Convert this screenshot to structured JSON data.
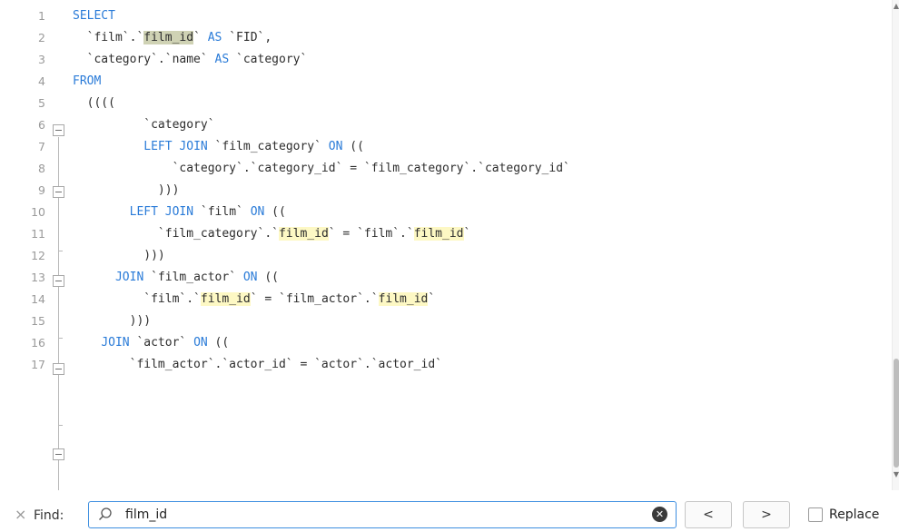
{
  "editor": {
    "lines": [
      {
        "num": "1",
        "segments": [
          {
            "t": "SELECT",
            "c": "kw"
          }
        ]
      },
      {
        "num": "2",
        "segments": [
          {
            "t": "  `film`.`"
          },
          {
            "t": "film_id",
            "c": "hl-cur"
          },
          {
            "t": "` "
          },
          {
            "t": "AS",
            "c": "kw"
          },
          {
            "t": " `FID`,"
          }
        ]
      },
      {
        "num": "3",
        "segments": [
          {
            "t": "  `category`.`name` "
          },
          {
            "t": "AS",
            "c": "kw"
          },
          {
            "t": " `category`"
          }
        ]
      },
      {
        "num": "4",
        "segments": [
          {
            "t": "FROM",
            "c": "kw"
          }
        ]
      },
      {
        "num": "5",
        "segments": [
          {
            "t": "  (((("
          }
        ]
      },
      {
        "num": "6",
        "segments": [
          {
            "t": "          `category`"
          }
        ]
      },
      {
        "num": "7",
        "segments": [
          {
            "t": "          "
          },
          {
            "t": "LEFT JOIN",
            "c": "kw"
          },
          {
            "t": " `film_category` "
          },
          {
            "t": "ON",
            "c": "kw"
          },
          {
            "t": " (("
          }
        ]
      },
      {
        "num": "8",
        "segments": [
          {
            "t": "              `category`.`category_id` = `film_category`.`category_id`"
          }
        ]
      },
      {
        "num": "9",
        "segments": [
          {
            "t": "            )))"
          }
        ]
      },
      {
        "num": "10",
        "segments": [
          {
            "t": "        "
          },
          {
            "t": "LEFT JOIN",
            "c": "kw"
          },
          {
            "t": " `film` "
          },
          {
            "t": "ON",
            "c": "kw"
          },
          {
            "t": " (("
          }
        ]
      },
      {
        "num": "11",
        "segments": [
          {
            "t": "            `film_category`.`"
          },
          {
            "t": "film_id",
            "c": "hl"
          },
          {
            "t": "` = `film`.`"
          },
          {
            "t": "film_id",
            "c": "hl"
          },
          {
            "t": "`"
          }
        ]
      },
      {
        "num": "12",
        "segments": [
          {
            "t": "          )))"
          }
        ]
      },
      {
        "num": "13",
        "segments": [
          {
            "t": "      "
          },
          {
            "t": "JOIN",
            "c": "kw"
          },
          {
            "t": " `film_actor` "
          },
          {
            "t": "ON",
            "c": "kw"
          },
          {
            "t": " (("
          }
        ]
      },
      {
        "num": "14",
        "segments": [
          {
            "t": "          `film`.`"
          },
          {
            "t": "film_id",
            "c": "hl"
          },
          {
            "t": "` = `film_actor`.`"
          },
          {
            "t": "film_id",
            "c": "hl"
          },
          {
            "t": "`"
          }
        ]
      },
      {
        "num": "15",
        "segments": [
          {
            "t": "        )))"
          }
        ]
      },
      {
        "num": "16",
        "segments": [
          {
            "t": "    "
          },
          {
            "t": "JOIN",
            "c": "kw"
          },
          {
            "t": " `actor` "
          },
          {
            "t": "ON",
            "c": "kw"
          },
          {
            "t": " (("
          }
        ]
      },
      {
        "num": "17",
        "segments": [
          {
            "t": "        `film_actor`.`actor_id` = `actor`.`actor_id`"
          }
        ]
      }
    ]
  },
  "findbar": {
    "close_icon": "×",
    "find_label": "Find:",
    "search_value": "film_id",
    "clear_icon": "✕",
    "prev_label": "<",
    "next_label": ">",
    "replace_label": "Replace"
  },
  "colors": {
    "keyword": "#2a7bd8",
    "match_highlight": "#fdf8c4",
    "current_match": "#cfd2b4",
    "focus_border": "#3d8ee0"
  },
  "icons": {
    "close": "close-icon",
    "search": "search-icon",
    "clear": "clear-icon",
    "prev": "chevron-left-icon",
    "next": "chevron-right-icon"
  }
}
